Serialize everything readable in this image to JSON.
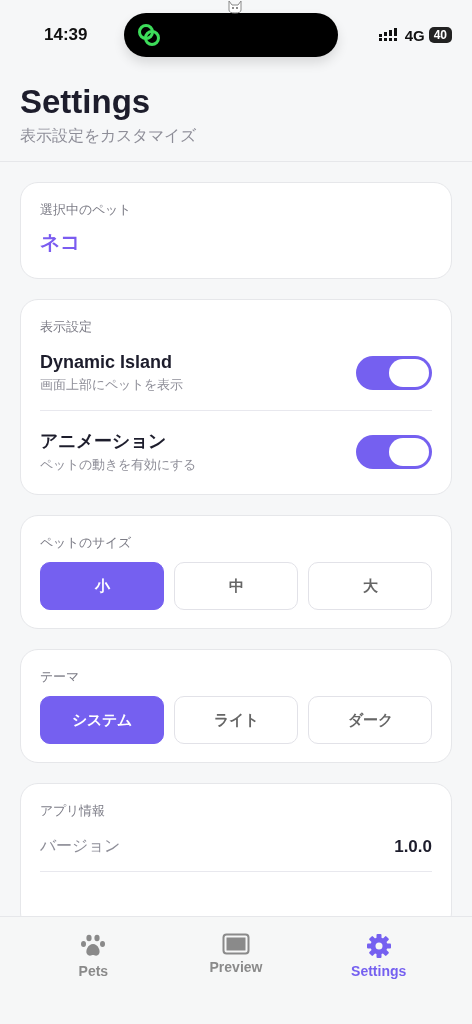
{
  "status_bar": {
    "time": "14:39",
    "network": "4G",
    "battery": "40"
  },
  "header": {
    "title": "Settings",
    "subtitle": "表示設定をカスタマイズ"
  },
  "selected_pet": {
    "label": "選択中のペット",
    "value": "ネコ"
  },
  "display": {
    "label": "表示設定",
    "rows": [
      {
        "title": "Dynamic Island",
        "description": "画面上部にペットを表示",
        "on": true
      },
      {
        "title": "アニメーション",
        "description": "ペットの動きを有効にする",
        "on": true
      }
    ]
  },
  "pet_size": {
    "label": "ペットのサイズ",
    "options": [
      {
        "label": "小",
        "selected": true
      },
      {
        "label": "中",
        "selected": false
      },
      {
        "label": "大",
        "selected": false
      }
    ]
  },
  "theme": {
    "label": "テーマ",
    "options": [
      {
        "label": "システム",
        "selected": true
      },
      {
        "label": "ライト",
        "selected": false
      },
      {
        "label": "ダーク",
        "selected": false
      }
    ]
  },
  "app_info": {
    "label": "アプリ情報",
    "rows": [
      {
        "label": "バージョン",
        "value": "1.0.0"
      }
    ]
  },
  "tab_bar": [
    {
      "label": "Pets",
      "kind": "paw",
      "selected": false
    },
    {
      "label": "Preview",
      "kind": "screen",
      "selected": false
    },
    {
      "label": "Settings",
      "kind": "gear",
      "selected": true
    }
  ]
}
